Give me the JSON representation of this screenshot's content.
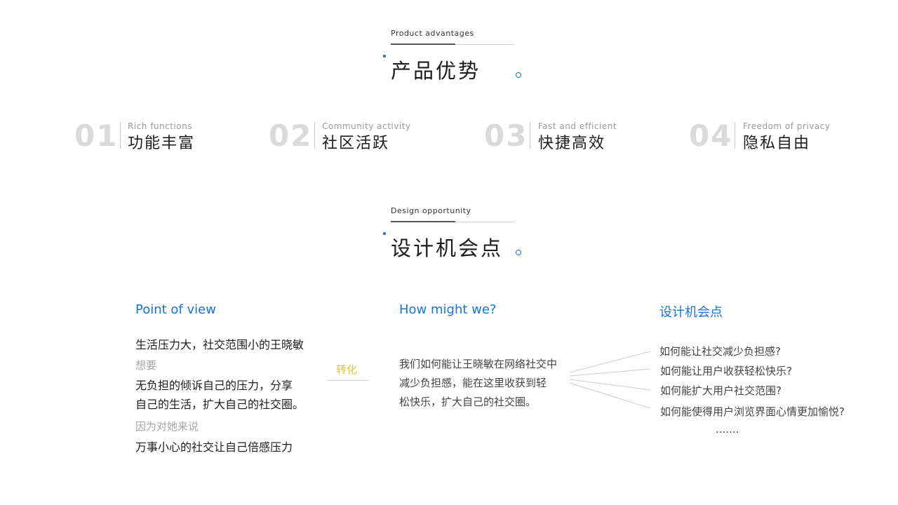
{
  "product": {
    "subtitle": "Product advantages",
    "title": "产品优势"
  },
  "advantages": [
    {
      "number": "01",
      "en": "Rich functions",
      "cn": "功能丰富"
    },
    {
      "number": "02",
      "en": "Community activity",
      "cn": "社区活跃"
    },
    {
      "number": "03",
      "en": "Fast and efficient",
      "cn": "快捷高效"
    },
    {
      "number": "04",
      "en": "Freedom of privacy",
      "cn": "隐私自由"
    }
  ],
  "design": {
    "subtitle": "Design opportunity",
    "title": "设计机会点"
  },
  "pov": {
    "title": "Point of view",
    "main": "生活压力大，社交范围小的王晓敏",
    "wants_label": "想要",
    "wants_line1": "无负担的倾诉自己的压力，分享",
    "wants_line2": "自己的生活，扩大自己的社交圈。",
    "because_label": "因为对她来说",
    "because_text": "万事小心的社交让自己倍感压力"
  },
  "convert_label": "转化",
  "hmw": {
    "title": "How might we?",
    "line1": "我们如何能让王晓敏在网络社交中",
    "line2": "减少负担感，能在这里收获到轻",
    "line3": "松快乐，扩大自己的社交圈。"
  },
  "opportunity": {
    "title": "设计机会点",
    "questions": [
      "如何能让社交减少负担感?",
      "如何能让用户收获轻松快乐?",
      "如何能扩大用户社交范围?",
      "如何能使得用户浏览界面心情更加愉悦?"
    ],
    "ellipsis": "......."
  },
  "colors": {
    "accent": "#1a73d9",
    "convert": "#e8c22c",
    "number_gray": "#dadada"
  }
}
